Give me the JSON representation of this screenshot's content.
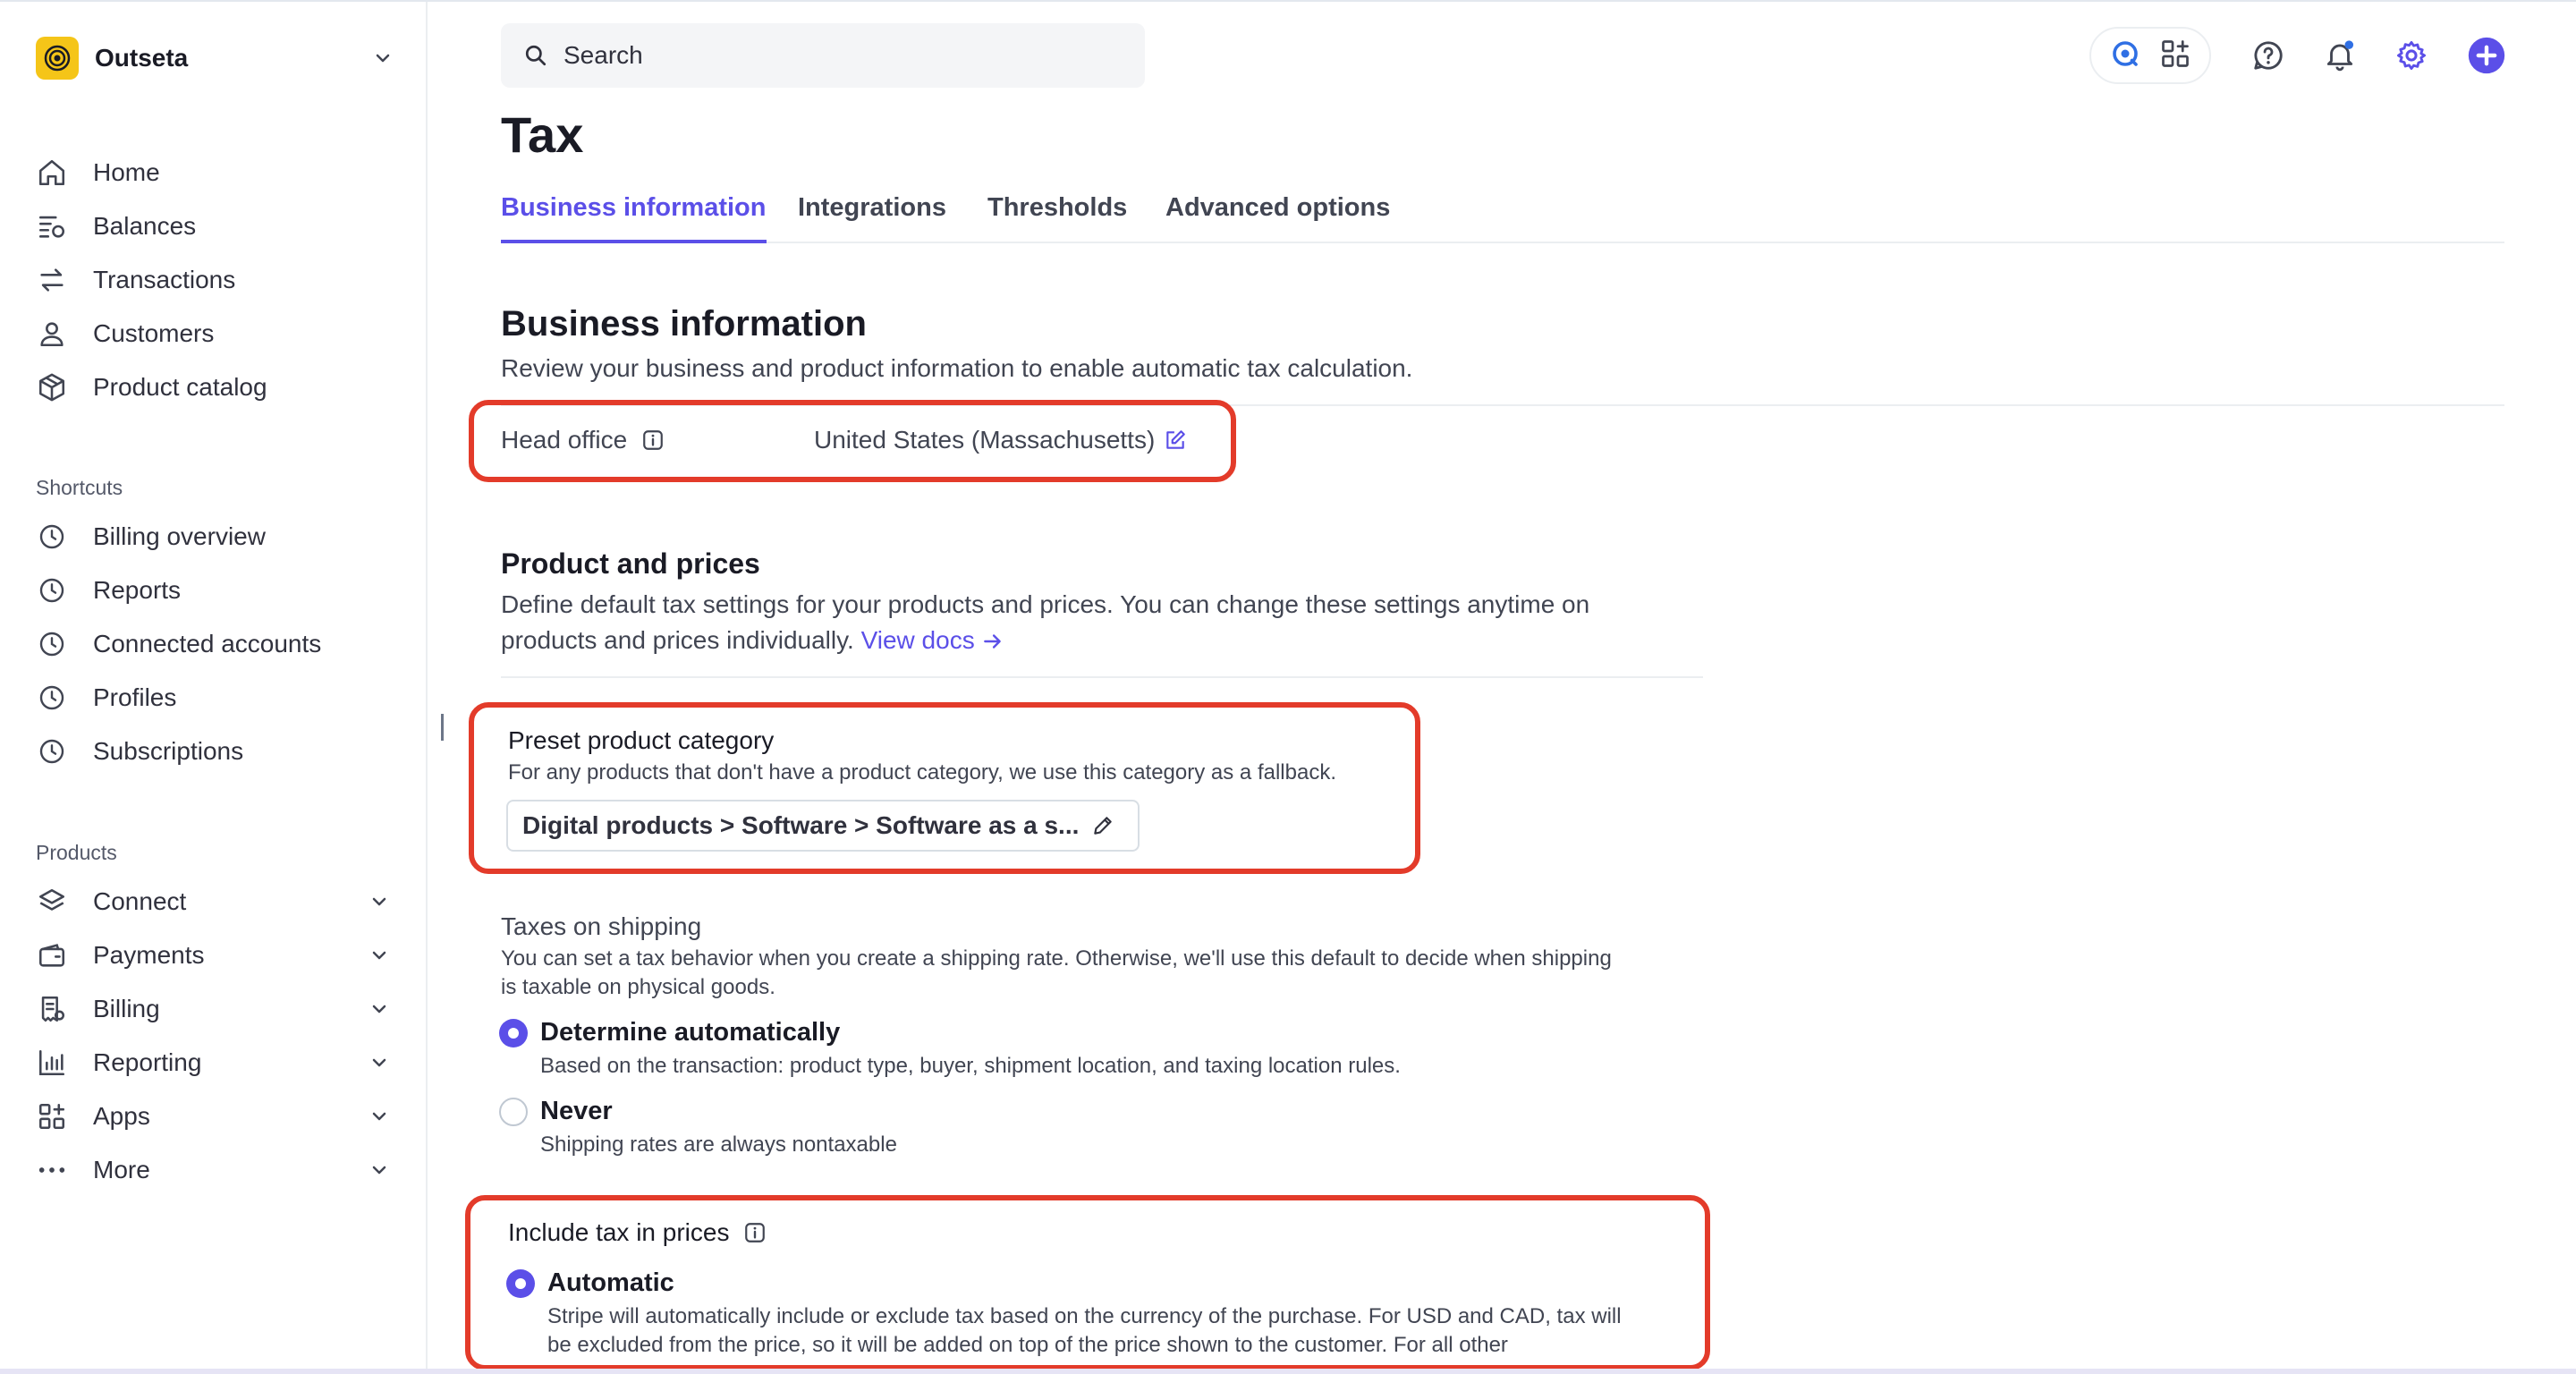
{
  "account": {
    "name": "Outseta"
  },
  "nav": {
    "main": [
      {
        "label": "Home",
        "icon": "home-icon"
      },
      {
        "label": "Balances",
        "icon": "balances-icon"
      },
      {
        "label": "Transactions",
        "icon": "transactions-icon"
      },
      {
        "label": "Customers",
        "icon": "customers-icon"
      },
      {
        "label": "Product catalog",
        "icon": "product-catalog-icon"
      }
    ],
    "shortcuts_label": "Shortcuts",
    "shortcuts": [
      {
        "label": "Billing overview"
      },
      {
        "label": "Reports"
      },
      {
        "label": "Connected accounts"
      },
      {
        "label": "Profiles"
      },
      {
        "label": "Subscriptions"
      }
    ],
    "products_label": "Products",
    "products": [
      {
        "label": "Connect",
        "icon": "connect-icon"
      },
      {
        "label": "Payments",
        "icon": "payments-icon"
      },
      {
        "label": "Billing",
        "icon": "billing-icon"
      },
      {
        "label": "Reporting",
        "icon": "reporting-icon"
      },
      {
        "label": "Apps",
        "icon": "apps-icon"
      },
      {
        "label": "More",
        "icon": "more-icon"
      }
    ]
  },
  "search": {
    "placeholder": "Search"
  },
  "page": {
    "title": "Tax"
  },
  "tabs": [
    {
      "label": "Business information",
      "active": true
    },
    {
      "label": "Integrations"
    },
    {
      "label": "Thresholds"
    },
    {
      "label": "Advanced options"
    }
  ],
  "business": {
    "title": "Business information",
    "description": "Review your business and product information to enable automatic tax calculation.",
    "head_office_label": "Head office",
    "head_office_value": "United States (Massachusetts)"
  },
  "products_prices": {
    "title": "Product and prices",
    "description_line1": "Define default tax settings for your products and prices. You can change these settings anytime on",
    "description_line2": "products and prices individually.",
    "view_docs": "View docs"
  },
  "preset_category": {
    "title": "Preset product category",
    "subtitle": "For any products that don't have a product category, we use this category as a fallback.",
    "value": "Digital products > Software > Software as a s..."
  },
  "shipping": {
    "title": "Taxes on shipping",
    "description_line1": "You can set a tax behavior when you create a shipping rate. Otherwise, we'll use this default to decide when shipping",
    "description_line2": "is taxable on physical goods.",
    "options": [
      {
        "label": "Determine automatically",
        "sub": "Based on the transaction: product type, buyer, shipment location, and taxing location rules.",
        "selected": true
      },
      {
        "label": "Never",
        "sub": "Shipping rates are always nontaxable",
        "selected": false
      }
    ]
  },
  "include_tax": {
    "title": "Include tax in prices",
    "option_label": "Automatic",
    "option_sub_line1": "Stripe will automatically include or exclude tax based on the currency of the purchase. For USD and CAD, tax will",
    "option_sub_line2": "be excluded from the price, so it will be added on top of the price shown to the customer. For all other"
  },
  "colors": {
    "accent": "#5b4fe8",
    "highlight": "#e33b2a",
    "logo": "#f5c518"
  }
}
